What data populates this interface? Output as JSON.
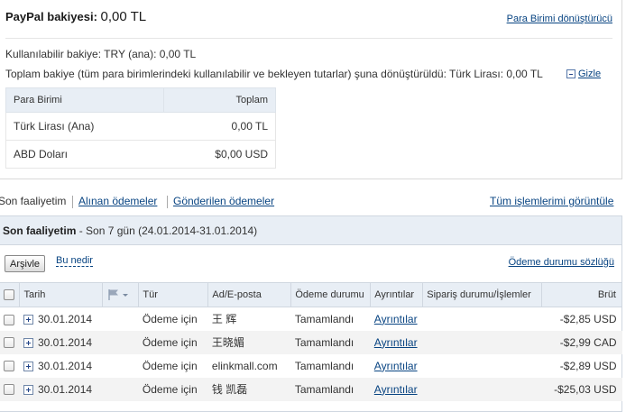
{
  "balance": {
    "title_label": "PayPal bakiyesi:",
    "title_amount": "0,00 TL",
    "currency_converter_link": "Para Birimi dönüştürücü",
    "available": "Kullanılabilir bakiye: TRY (ana): 0,00 TL",
    "total": "Toplam bakiye (tüm para birimlerindeki kullanılabilir ve bekleyen tutarlar) şuna dönüştürüldü: Türk Lirası: 0,00 TL",
    "hide_link": "Gizle",
    "table": {
      "headers": [
        "Para Birimi",
        "Toplam"
      ],
      "rows": [
        [
          "Türk Lirası (Ana)",
          "0,00 TL"
        ],
        [
          "ABD Doları",
          "$0,00 USD"
        ]
      ]
    }
  },
  "activity_nav": {
    "items": [
      "Son faaliyetim",
      "Alınan ödemeler",
      "Gönderilen ödemeler"
    ],
    "all_link": "Tüm işlemlerimi görüntüle"
  },
  "activity": {
    "title": "Son faaliyetim",
    "subtitle": " - Son 7 gün (24.01.2014-31.01.2014)",
    "archive_button": "Arşivle",
    "what_link": "Bu nedir",
    "glossary_link": "Ödeme durumu sözlüğü",
    "columns": [
      "Tarih",
      "Tür",
      "Ad/E-posta",
      "Ödeme durumu",
      "Ayrıntılar",
      "Sipariş durumu/İşlemler",
      "Brüt"
    ],
    "rows": [
      {
        "date": "30.01.2014",
        "type": "Ödeme için",
        "name": "王 辉",
        "status": "Tamamlandı",
        "details": "Ayrıntılar",
        "order": "",
        "gross": "-$2,85 USD"
      },
      {
        "date": "30.01.2014",
        "type": "Ödeme için",
        "name": "王晓媚",
        "status": "Tamamlandı",
        "details": "Ayrıntılar",
        "order": "",
        "gross": "-$2,99 CAD"
      },
      {
        "date": "30.01.2014",
        "type": "Ödeme için",
        "name": "elinkmall.com",
        "status": "Tamamlandı",
        "details": "Ayrıntılar",
        "order": "",
        "gross": "-$2,89 USD"
      },
      {
        "date": "30.01.2014",
        "type": "Ödeme için",
        "name": "钱 凯磊",
        "status": "Tamamlandı",
        "details": "Ayrıntılar",
        "order": "",
        "gross": "-$25,03 USD"
      }
    ]
  },
  "colors": {
    "link": "#084482",
    "header_bg": "#e8eef5"
  }
}
